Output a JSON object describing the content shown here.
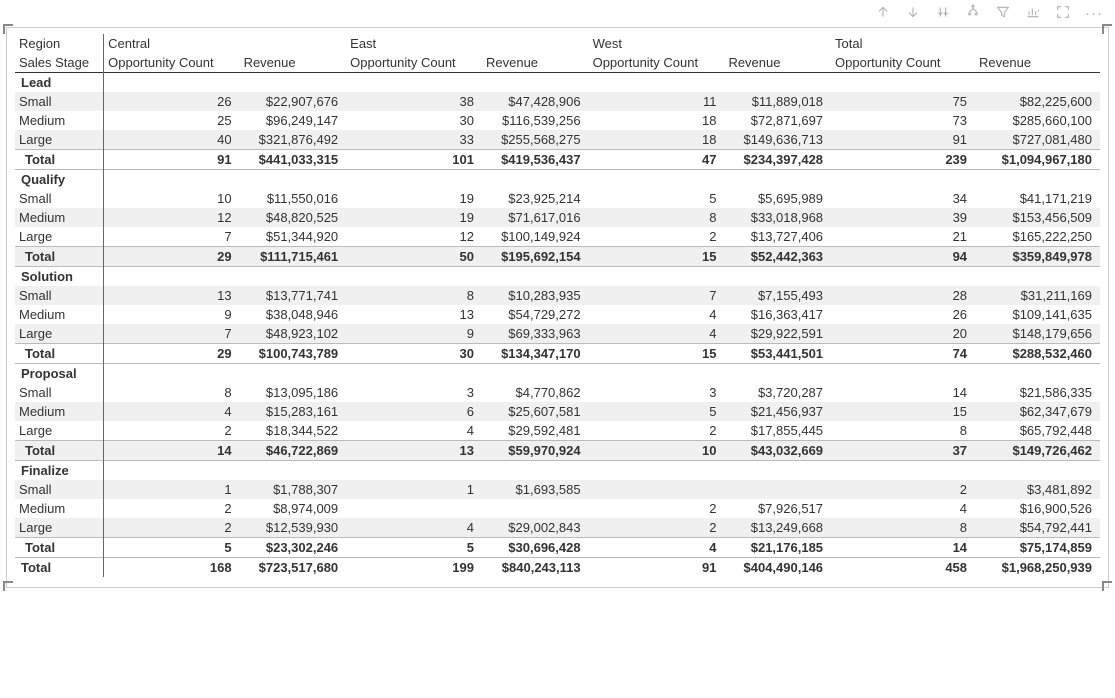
{
  "toolbar": {
    "icons": [
      "up-icon",
      "down-icon",
      "drill-expand-icon",
      "hierarchy-icon",
      "filter-icon",
      "chart-icon",
      "focus-icon",
      "more-icon"
    ]
  },
  "headers": {
    "region_label": "Region",
    "stage_label": "Sales Stage",
    "regions": [
      "Central",
      "East",
      "West",
      "Total"
    ],
    "value_cols": [
      "Opportunity Count",
      "Revenue"
    ]
  },
  "rows": [
    {
      "kind": "stage",
      "label": "Lead"
    },
    {
      "kind": "data",
      "alt": true,
      "label": "Small",
      "cells": [
        "26",
        "$22,907,676",
        "38",
        "$47,428,906",
        "11",
        "$11,889,018",
        "75",
        "$82,225,600"
      ]
    },
    {
      "kind": "data",
      "label": "Medium",
      "cells": [
        "25",
        "$96,249,147",
        "30",
        "$116,539,256",
        "18",
        "$72,871,697",
        "73",
        "$285,660,100"
      ]
    },
    {
      "kind": "data",
      "alt": true,
      "label": "Large",
      "cells": [
        "40",
        "$321,876,492",
        "33",
        "$255,568,275",
        "18",
        "$149,636,713",
        "91",
        "$727,081,480"
      ]
    },
    {
      "kind": "subtotal",
      "label": "Total",
      "cells": [
        "91",
        "$441,033,315",
        "101",
        "$419,536,437",
        "47",
        "$234,397,428",
        "239",
        "$1,094,967,180"
      ]
    },
    {
      "kind": "stage",
      "label": "Qualify"
    },
    {
      "kind": "data",
      "label": "Small",
      "cells": [
        "10",
        "$11,550,016",
        "19",
        "$23,925,214",
        "5",
        "$5,695,989",
        "34",
        "$41,171,219"
      ]
    },
    {
      "kind": "data",
      "alt": true,
      "label": "Medium",
      "cells": [
        "12",
        "$48,820,525",
        "19",
        "$71,617,016",
        "8",
        "$33,018,968",
        "39",
        "$153,456,509"
      ]
    },
    {
      "kind": "data",
      "label": "Large",
      "cells": [
        "7",
        "$51,344,920",
        "12",
        "$100,149,924",
        "2",
        "$13,727,406",
        "21",
        "$165,222,250"
      ]
    },
    {
      "kind": "subtotal",
      "alt": true,
      "label": "Total",
      "cells": [
        "29",
        "$111,715,461",
        "50",
        "$195,692,154",
        "15",
        "$52,442,363",
        "94",
        "$359,849,978"
      ]
    },
    {
      "kind": "stage",
      "label": "Solution"
    },
    {
      "kind": "data",
      "alt": true,
      "label": "Small",
      "cells": [
        "13",
        "$13,771,741",
        "8",
        "$10,283,935",
        "7",
        "$7,155,493",
        "28",
        "$31,211,169"
      ]
    },
    {
      "kind": "data",
      "label": "Medium",
      "cells": [
        "9",
        "$38,048,946",
        "13",
        "$54,729,272",
        "4",
        "$16,363,417",
        "26",
        "$109,141,635"
      ]
    },
    {
      "kind": "data",
      "alt": true,
      "label": "Large",
      "cells": [
        "7",
        "$48,923,102",
        "9",
        "$69,333,963",
        "4",
        "$29,922,591",
        "20",
        "$148,179,656"
      ]
    },
    {
      "kind": "subtotal",
      "label": "Total",
      "cells": [
        "29",
        "$100,743,789",
        "30",
        "$134,347,170",
        "15",
        "$53,441,501",
        "74",
        "$288,532,460"
      ]
    },
    {
      "kind": "stage",
      "label": "Proposal"
    },
    {
      "kind": "data",
      "label": "Small",
      "cells": [
        "8",
        "$13,095,186",
        "3",
        "$4,770,862",
        "3",
        "$3,720,287",
        "14",
        "$21,586,335"
      ]
    },
    {
      "kind": "data",
      "alt": true,
      "label": "Medium",
      "cells": [
        "4",
        "$15,283,161",
        "6",
        "$25,607,581",
        "5",
        "$21,456,937",
        "15",
        "$62,347,679"
      ]
    },
    {
      "kind": "data",
      "label": "Large",
      "cells": [
        "2",
        "$18,344,522",
        "4",
        "$29,592,481",
        "2",
        "$17,855,445",
        "8",
        "$65,792,448"
      ]
    },
    {
      "kind": "subtotal",
      "alt": true,
      "label": "Total",
      "cells": [
        "14",
        "$46,722,869",
        "13",
        "$59,970,924",
        "10",
        "$43,032,669",
        "37",
        "$149,726,462"
      ]
    },
    {
      "kind": "stage",
      "label": "Finalize"
    },
    {
      "kind": "data",
      "alt": true,
      "label": "Small",
      "cells": [
        "1",
        "$1,788,307",
        "1",
        "$1,693,585",
        "",
        "",
        "2",
        "$3,481,892"
      ]
    },
    {
      "kind": "data",
      "label": "Medium",
      "cells": [
        "2",
        "$8,974,009",
        "",
        "",
        "2",
        "$7,926,517",
        "4",
        "$16,900,526"
      ]
    },
    {
      "kind": "data",
      "alt": true,
      "label": "Large",
      "cells": [
        "2",
        "$12,539,930",
        "4",
        "$29,002,843",
        "2",
        "$13,249,668",
        "8",
        "$54,792,441"
      ]
    },
    {
      "kind": "subtotal",
      "label": "Total",
      "cells": [
        "5",
        "$23,302,246",
        "5",
        "$30,696,428",
        "4",
        "$21,176,185",
        "14",
        "$75,174,859"
      ]
    },
    {
      "kind": "grandtotal",
      "label": "Total",
      "cells": [
        "168",
        "$723,517,680",
        "199",
        "$840,243,113",
        "91",
        "$404,490,146",
        "458",
        "$1,968,250,939"
      ]
    }
  ]
}
